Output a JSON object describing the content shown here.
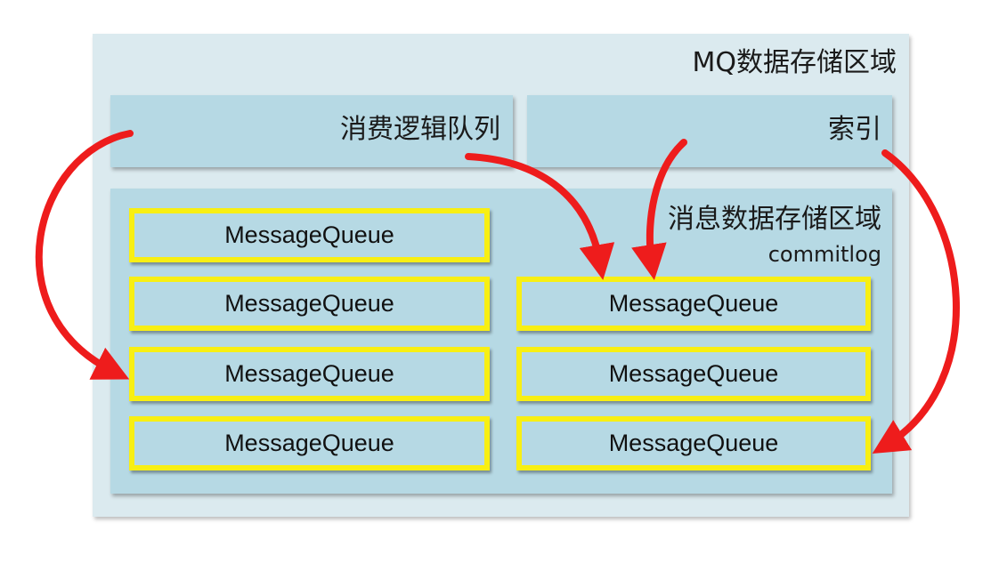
{
  "outer": {
    "title": "MQ数据存储区域"
  },
  "consumer_queue": {
    "title": "消费逻辑队列"
  },
  "index": {
    "title": "索引"
  },
  "commitlog": {
    "title": "消息数据存储区域",
    "subtitle": "commitlog"
  },
  "message_queues": [
    "MessageQueue",
    "MessageQueue",
    "MessageQueue",
    "MessageQueue",
    "MessageQueue",
    "MessageQueue",
    "MessageQueue"
  ],
  "colors": {
    "outer_bg": "#dbeaef",
    "panel_bg": "#b6d9e4",
    "queue_border": "#f8ef13",
    "arrow": "#ee1c1c"
  }
}
